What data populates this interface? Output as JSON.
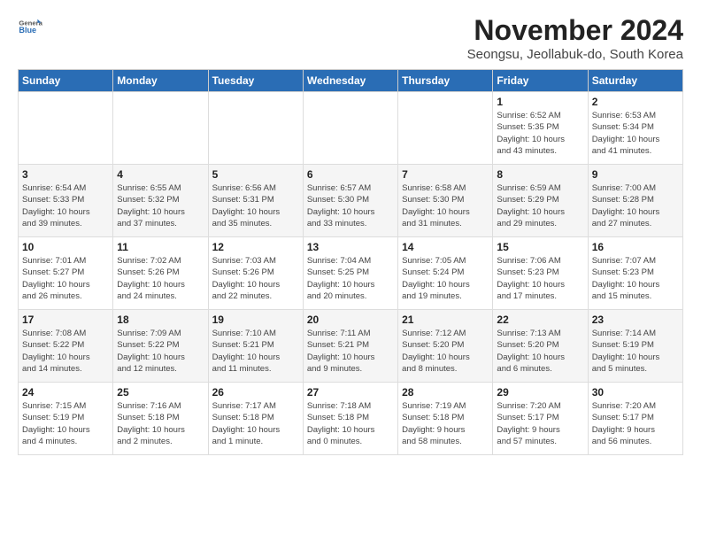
{
  "header": {
    "logo_general": "General",
    "logo_blue": "Blue",
    "month_title": "November 2024",
    "subtitle": "Seongsu, Jeollabuk-do, South Korea"
  },
  "columns": [
    "Sunday",
    "Monday",
    "Tuesday",
    "Wednesday",
    "Thursday",
    "Friday",
    "Saturday"
  ],
  "weeks": [
    [
      {
        "day": "",
        "info": ""
      },
      {
        "day": "",
        "info": ""
      },
      {
        "day": "",
        "info": ""
      },
      {
        "day": "",
        "info": ""
      },
      {
        "day": "",
        "info": ""
      },
      {
        "day": "1",
        "info": "Sunrise: 6:52 AM\nSunset: 5:35 PM\nDaylight: 10 hours\nand 43 minutes."
      },
      {
        "day": "2",
        "info": "Sunrise: 6:53 AM\nSunset: 5:34 PM\nDaylight: 10 hours\nand 41 minutes."
      }
    ],
    [
      {
        "day": "3",
        "info": "Sunrise: 6:54 AM\nSunset: 5:33 PM\nDaylight: 10 hours\nand 39 minutes."
      },
      {
        "day": "4",
        "info": "Sunrise: 6:55 AM\nSunset: 5:32 PM\nDaylight: 10 hours\nand 37 minutes."
      },
      {
        "day": "5",
        "info": "Sunrise: 6:56 AM\nSunset: 5:31 PM\nDaylight: 10 hours\nand 35 minutes."
      },
      {
        "day": "6",
        "info": "Sunrise: 6:57 AM\nSunset: 5:30 PM\nDaylight: 10 hours\nand 33 minutes."
      },
      {
        "day": "7",
        "info": "Sunrise: 6:58 AM\nSunset: 5:30 PM\nDaylight: 10 hours\nand 31 minutes."
      },
      {
        "day": "8",
        "info": "Sunrise: 6:59 AM\nSunset: 5:29 PM\nDaylight: 10 hours\nand 29 minutes."
      },
      {
        "day": "9",
        "info": "Sunrise: 7:00 AM\nSunset: 5:28 PM\nDaylight: 10 hours\nand 27 minutes."
      }
    ],
    [
      {
        "day": "10",
        "info": "Sunrise: 7:01 AM\nSunset: 5:27 PM\nDaylight: 10 hours\nand 26 minutes."
      },
      {
        "day": "11",
        "info": "Sunrise: 7:02 AM\nSunset: 5:26 PM\nDaylight: 10 hours\nand 24 minutes."
      },
      {
        "day": "12",
        "info": "Sunrise: 7:03 AM\nSunset: 5:26 PM\nDaylight: 10 hours\nand 22 minutes."
      },
      {
        "day": "13",
        "info": "Sunrise: 7:04 AM\nSunset: 5:25 PM\nDaylight: 10 hours\nand 20 minutes."
      },
      {
        "day": "14",
        "info": "Sunrise: 7:05 AM\nSunset: 5:24 PM\nDaylight: 10 hours\nand 19 minutes."
      },
      {
        "day": "15",
        "info": "Sunrise: 7:06 AM\nSunset: 5:23 PM\nDaylight: 10 hours\nand 17 minutes."
      },
      {
        "day": "16",
        "info": "Sunrise: 7:07 AM\nSunset: 5:23 PM\nDaylight: 10 hours\nand 15 minutes."
      }
    ],
    [
      {
        "day": "17",
        "info": "Sunrise: 7:08 AM\nSunset: 5:22 PM\nDaylight: 10 hours\nand 14 minutes."
      },
      {
        "day": "18",
        "info": "Sunrise: 7:09 AM\nSunset: 5:22 PM\nDaylight: 10 hours\nand 12 minutes."
      },
      {
        "day": "19",
        "info": "Sunrise: 7:10 AM\nSunset: 5:21 PM\nDaylight: 10 hours\nand 11 minutes."
      },
      {
        "day": "20",
        "info": "Sunrise: 7:11 AM\nSunset: 5:21 PM\nDaylight: 10 hours\nand 9 minutes."
      },
      {
        "day": "21",
        "info": "Sunrise: 7:12 AM\nSunset: 5:20 PM\nDaylight: 10 hours\nand 8 minutes."
      },
      {
        "day": "22",
        "info": "Sunrise: 7:13 AM\nSunset: 5:20 PM\nDaylight: 10 hours\nand 6 minutes."
      },
      {
        "day": "23",
        "info": "Sunrise: 7:14 AM\nSunset: 5:19 PM\nDaylight: 10 hours\nand 5 minutes."
      }
    ],
    [
      {
        "day": "24",
        "info": "Sunrise: 7:15 AM\nSunset: 5:19 PM\nDaylight: 10 hours\nand 4 minutes."
      },
      {
        "day": "25",
        "info": "Sunrise: 7:16 AM\nSunset: 5:18 PM\nDaylight: 10 hours\nand 2 minutes."
      },
      {
        "day": "26",
        "info": "Sunrise: 7:17 AM\nSunset: 5:18 PM\nDaylight: 10 hours\nand 1 minute."
      },
      {
        "day": "27",
        "info": "Sunrise: 7:18 AM\nSunset: 5:18 PM\nDaylight: 10 hours\nand 0 minutes."
      },
      {
        "day": "28",
        "info": "Sunrise: 7:19 AM\nSunset: 5:18 PM\nDaylight: 9 hours\nand 58 minutes."
      },
      {
        "day": "29",
        "info": "Sunrise: 7:20 AM\nSunset: 5:17 PM\nDaylight: 9 hours\nand 57 minutes."
      },
      {
        "day": "30",
        "info": "Sunrise: 7:20 AM\nSunset: 5:17 PM\nDaylight: 9 hours\nand 56 minutes."
      }
    ]
  ]
}
